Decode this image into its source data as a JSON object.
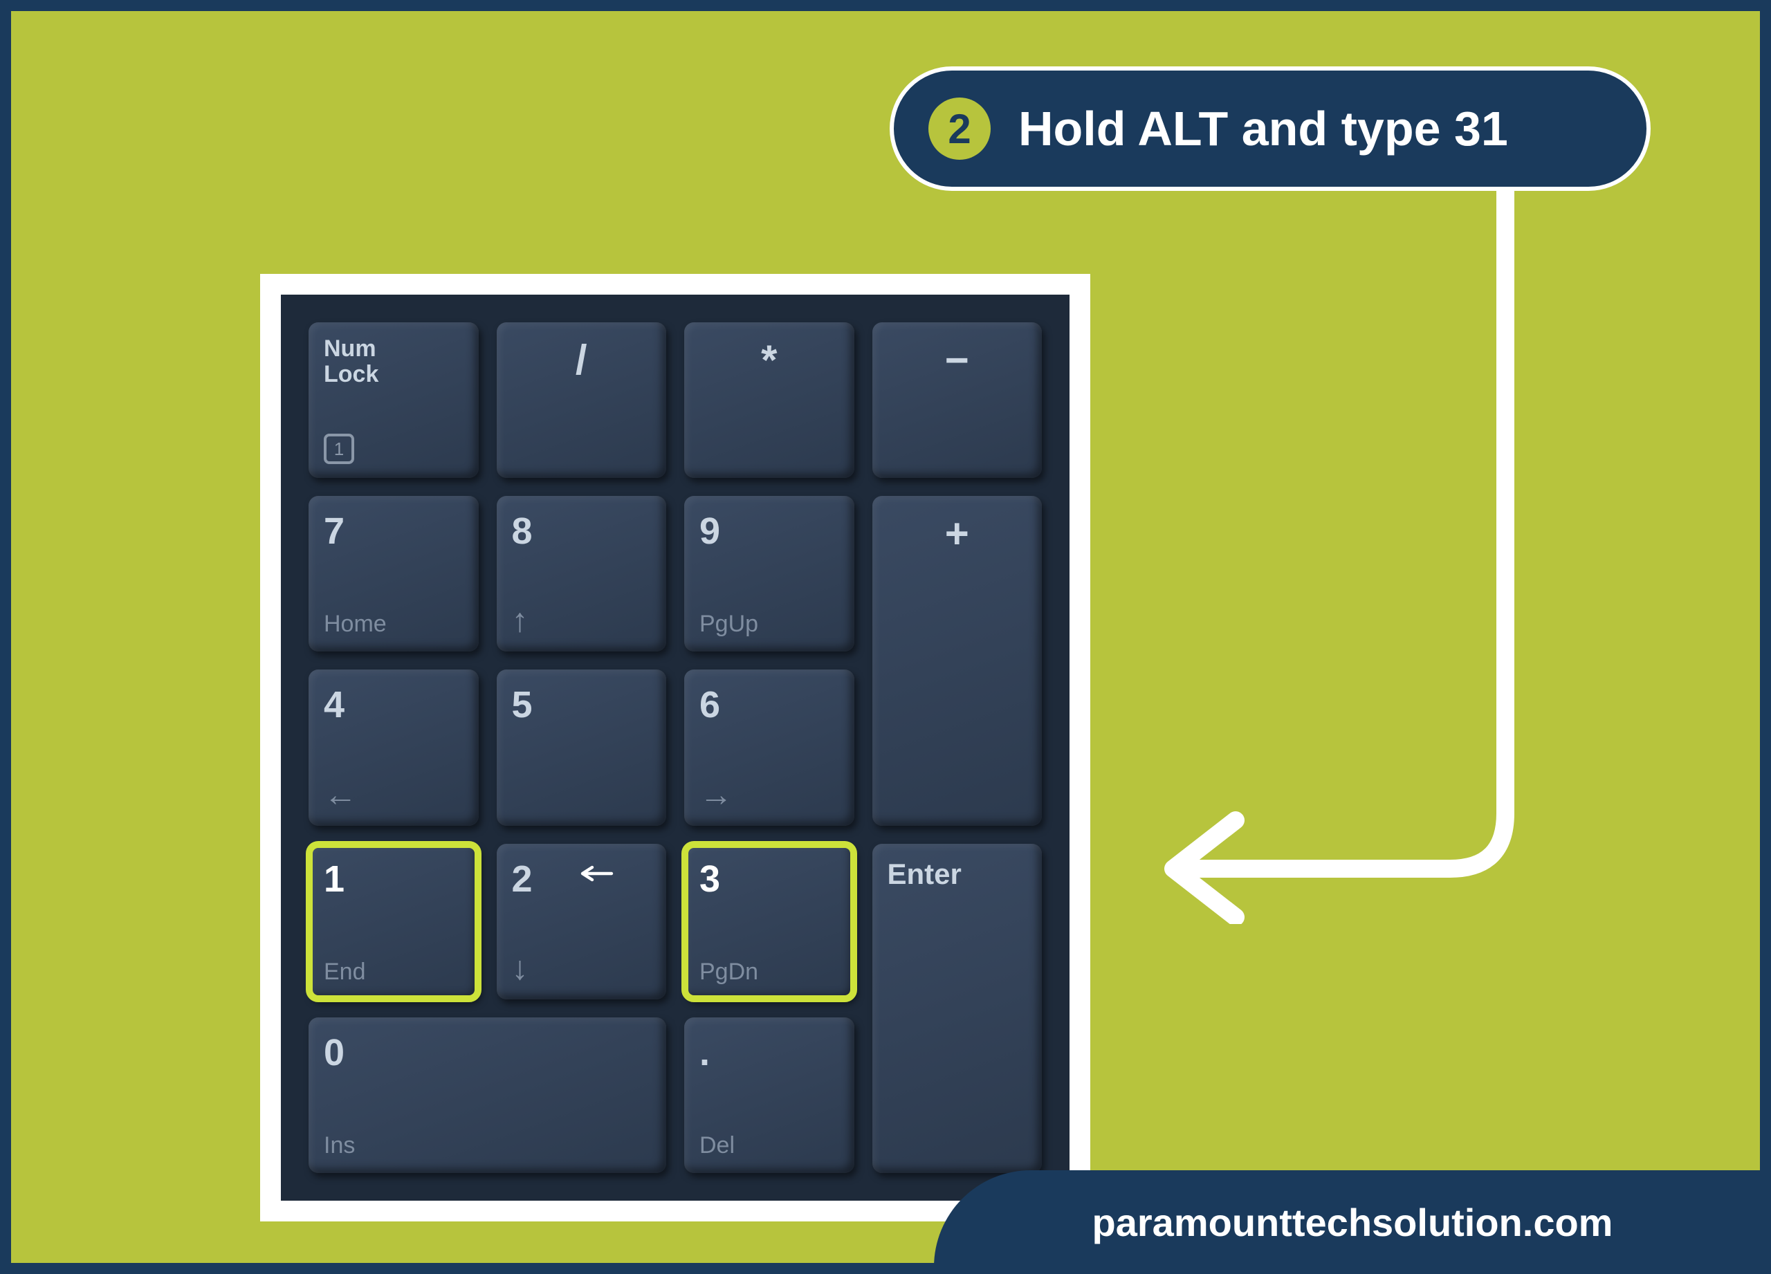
{
  "step": {
    "number": "2",
    "text": "Hold ALT and type 31"
  },
  "numpad": {
    "numlock_main": "Num\nLock",
    "numlock_icon": "1",
    "divide": "/",
    "multiply": "*",
    "minus": "−",
    "k7_main": "7",
    "k7_sub": "Home",
    "k8_main": "8",
    "k8_sub": "↑",
    "k9_main": "9",
    "k9_sub": "PgUp",
    "plus": "+",
    "k4_main": "4",
    "k4_sub": "←",
    "k5_main": "5",
    "k5_sub": "",
    "k6_main": "6",
    "k6_sub": "→",
    "k1_main": "1",
    "k1_sub": "End",
    "k2_main": "2",
    "k2_sub": "↓",
    "k3_main": "3",
    "k3_sub": "PgDn",
    "enter": "Enter",
    "k0_main": "0",
    "k0_sub": "Ins",
    "dot_main": ".",
    "dot_sub": "Del"
  },
  "highlighted_keys": [
    "1",
    "3"
  ],
  "footer": "paramounttechsolution.com"
}
